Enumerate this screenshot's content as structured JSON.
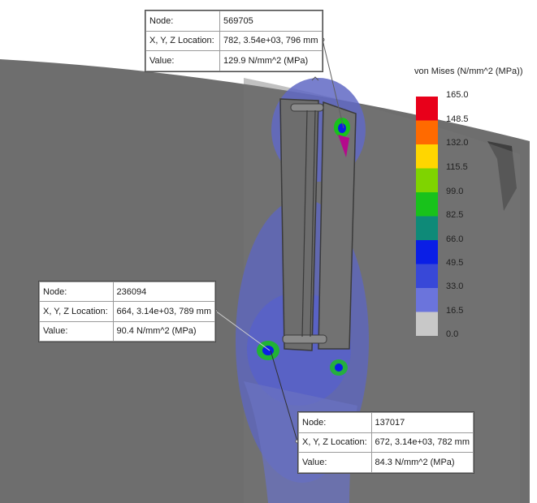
{
  "legend": {
    "title": "von Mises (N/mm^2 (MPa))",
    "levels": [
      {
        "value": "165.0",
        "color": "#e8001a"
      },
      {
        "value": "148.5",
        "color": "#ff6a00"
      },
      {
        "value": "132.0",
        "color": "#ffd600"
      },
      {
        "value": "115.5",
        "color": "#7fd400"
      },
      {
        "value": "99.0",
        "color": "#18c21b"
      },
      {
        "value": "82.5",
        "color": "#0e8a78"
      },
      {
        "value": "66.0",
        "color": "#0a1ee6"
      },
      {
        "value": "49.5",
        "color": "#3848d8"
      },
      {
        "value": "33.0",
        "color": "#6b74dc"
      },
      {
        "value": "16.5",
        "color": "#a9aee3"
      },
      {
        "value": "0.0",
        "color": "#c8c8c8"
      }
    ]
  },
  "probes": [
    {
      "node_label": "Node:",
      "node": "569705",
      "loc_label": "X, Y, Z Location:",
      "location": "782, 3.54e+03, 796 mm",
      "value_label": "Value:",
      "value": "129.9 N/mm^2 (MPa)"
    },
    {
      "node_label": "Node:",
      "node": "236094",
      "loc_label": "X, Y, Z Location:",
      "location": "664, 3.14e+03, 789 mm",
      "value_label": "Value:",
      "value": "90.4 N/mm^2 (MPa)"
    },
    {
      "node_label": "Node:",
      "node": "137017",
      "loc_label": "X, Y, Z Location:",
      "location": "672, 3.14e+03, 782 mm",
      "value_label": "Value:",
      "value": "84.3 N/mm^2 (MPa)"
    }
  ]
}
